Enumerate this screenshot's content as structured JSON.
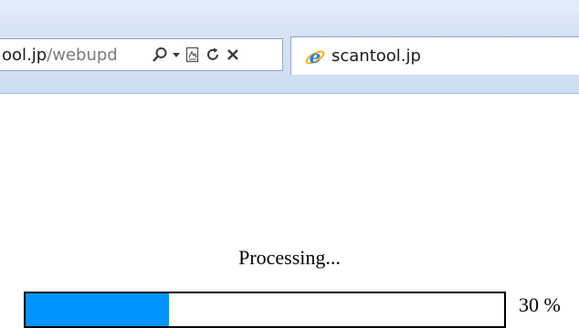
{
  "browser": {
    "address": {
      "domain": "ool.jp",
      "path": "/webupd",
      "icons": [
        "search-icon",
        "dropdown-arrow-icon",
        "compatibility-view-icon",
        "refresh-icon",
        "stop-icon"
      ]
    },
    "tab": {
      "title": "scantool.jp",
      "icon": "ie-favicon"
    }
  },
  "page": {
    "status": "Processing...",
    "progress": {
      "value_percent": 30,
      "label": "30 %",
      "fill_color": "#0094ff"
    }
  }
}
